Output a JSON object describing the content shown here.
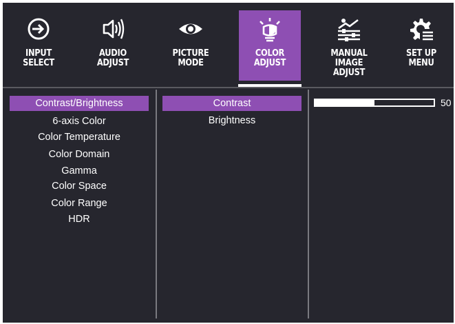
{
  "colors": {
    "background": "#26262e",
    "accent": "#8e4fb3",
    "text": "#ffffff",
    "divider": "#7a7a80"
  },
  "tabs": [
    {
      "label": "INPUT\nSELECT",
      "icon": "input-select-icon",
      "active": false
    },
    {
      "label": "AUDIO\nADJUST",
      "icon": "speaker-icon",
      "active": false
    },
    {
      "label": "PICTURE\nMODE",
      "icon": "eye-icon",
      "active": false
    },
    {
      "label": "COLOR\nADJUST",
      "icon": "color-bulb-icon",
      "active": true
    },
    {
      "label": "MANUAL\nIMAGE ADJUST",
      "icon": "image-adjust-icon",
      "active": false
    },
    {
      "label": "SET UP\nMENU",
      "icon": "gear-icon",
      "active": false
    }
  ],
  "color_adjust_menu": {
    "items": [
      "Contrast/Brightness",
      "6-axis Color",
      "Color Temperature",
      "Color Domain",
      "Gamma",
      "Color Space",
      "Color Range",
      "HDR"
    ],
    "selected": "Contrast/Brightness"
  },
  "contrast_brightness_submenu": {
    "items": [
      "Contrast",
      "Brightness"
    ],
    "selected": "Contrast"
  },
  "contrast_slider": {
    "value": "50",
    "min": 0,
    "max": 100,
    "fill_fraction": 0.5
  }
}
